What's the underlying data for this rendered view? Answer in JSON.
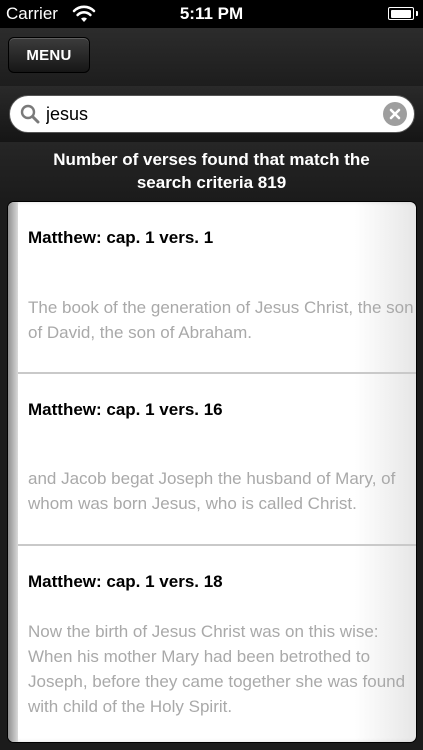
{
  "status_bar": {
    "carrier": "Carrier",
    "time": "5:11 PM",
    "wifi_icon": "wifi-icon",
    "battery_icon": "battery-icon"
  },
  "toolbar": {
    "menu_label": "MENU"
  },
  "search": {
    "value": "jesus",
    "search_icon": "search-icon",
    "clear_icon": "clear-icon"
  },
  "results_header": {
    "line1": "Number of verses found that match the",
    "line2": "search criteria 819"
  },
  "results": [
    {
      "title": "Matthew: cap. 1 vers. 1",
      "text": "The book of the generation of Jesus Christ, the son of David, the son of Abraham."
    },
    {
      "title": "Matthew: cap. 1 vers. 16",
      "text": "and Jacob begat Joseph the husband of Mary, of whom was born Jesus, who is called Christ."
    },
    {
      "title": "Matthew: cap. 1 vers. 18",
      "text": "Now the birth of Jesus Christ was on this wise: When his mother Mary had been betrothed to Joseph, before they came together she was found with child of the Holy Spirit."
    }
  ]
}
